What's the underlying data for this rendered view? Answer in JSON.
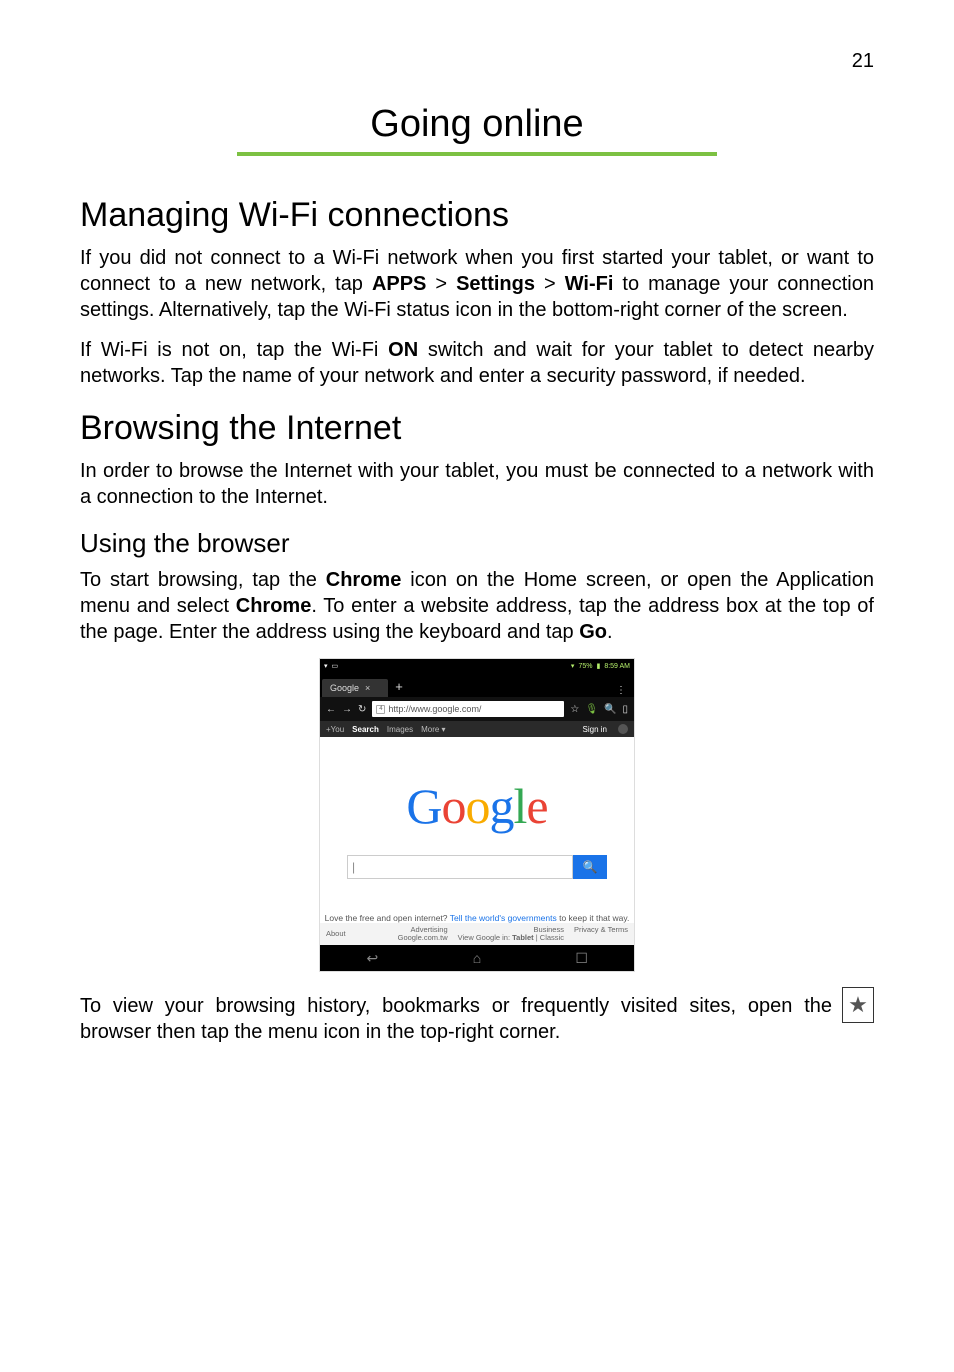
{
  "page_number": "21",
  "title": "Going online",
  "section_wifi": {
    "heading": "Managing Wi-Fi connections",
    "para1_parts": [
      "If you did not connect to a Wi-Fi network when you first started your tablet, or want to connect to a new network, tap ",
      "APPS",
      " > ",
      "Settings",
      " > ",
      "Wi-Fi",
      " to manage your connection settings. Alternatively, tap the Wi-Fi status icon in the bottom-right corner of the screen."
    ],
    "para2_parts": [
      "If Wi-Fi is not on, tap the Wi-Fi ",
      "ON",
      " switch and wait for your tablet to detect nearby networks. Tap the name of your network and enter a security password, if needed."
    ]
  },
  "section_browse": {
    "heading": "Browsing the Internet",
    "para1": "In order to browse the Internet with your tablet, you must be connected to a network with a connection to the Internet."
  },
  "section_using": {
    "heading": "Using the browser",
    "para_parts": [
      "To start browsing, tap the ",
      "Chrome",
      " icon on the Home screen, or open the Application menu and select ",
      "Chrome",
      ". To enter a website address, tap the address box at the top of the page. Enter the address using the keyboard and tap ",
      "Go",
      "."
    ]
  },
  "screenshot": {
    "status": {
      "battery_text": "75%",
      "time": "8:59 AM"
    },
    "tab_label": "Google",
    "url_favicon_label": "4",
    "url": "http://www.google.com/",
    "top_links": [
      "+You",
      "Search",
      "Images",
      "More ▾"
    ],
    "signin": "Sign in",
    "logo_letters": [
      "G",
      "o",
      "o",
      "g",
      "l",
      "e"
    ],
    "promo_plain": "Love the free and open internet? ",
    "promo_link": "Tell the world's governments",
    "promo_tail": " to keep it that way.",
    "footer_left": "About",
    "footer_mid_top": "Advertising",
    "footer_mid_bot": "Google.com.tw",
    "footer_r_top": "Business",
    "footer_r_bot_a": "View Google in: ",
    "footer_r_bot_b": "Tablet",
    "footer_r_bot_c": " | Classic",
    "footer_terms": "Privacy & Terms"
  },
  "last_para": "To view your browsing history, bookmarks or frequently visited sites, open the browser then tap the menu icon in the top-right corner."
}
